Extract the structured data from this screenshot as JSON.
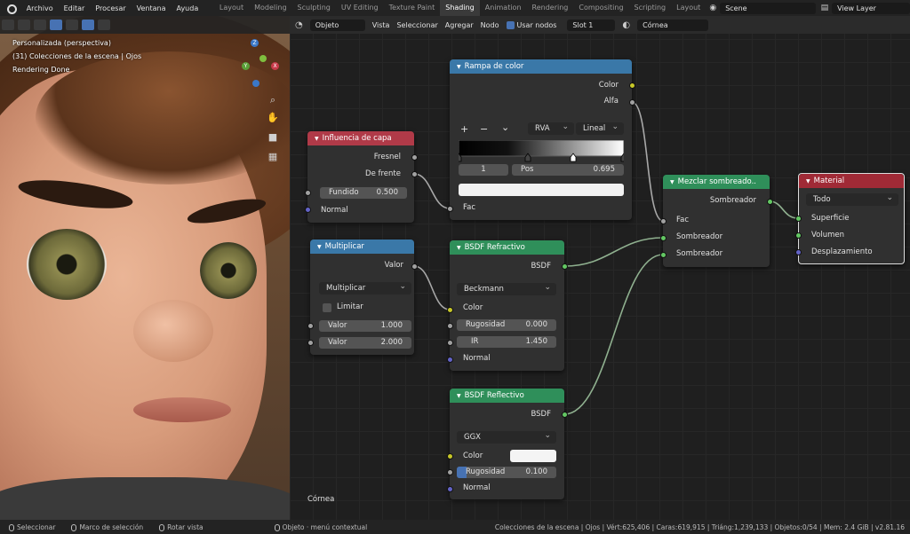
{
  "menubar": {
    "items": [
      "Archivo",
      "Editar",
      "Procesar",
      "Ventana",
      "Ayuda"
    ],
    "workspaces": [
      "Layout",
      "Modeling",
      "Sculpting",
      "UV Editing",
      "Texture Paint",
      "Shading",
      "Animation",
      "Rendering",
      "Compositing",
      "Scripting",
      "Layout"
    ],
    "active_workspace_index": 5,
    "scene": "Scene",
    "view_layer": "View Layer"
  },
  "viewport": {
    "line1": "Personalizada (perspectiva)",
    "line2": "(31) Colecciones de la escena | Ojos",
    "line3": "Rendering Done",
    "gizmo_labels": {
      "z": "Z",
      "y": "Y",
      "x": "X"
    }
  },
  "editor_header": {
    "object_mode": "Objeto",
    "menu": [
      "Vista",
      "Seleccionar",
      "Agregar",
      "Nodo"
    ],
    "use_nodes": "Usar nodos",
    "slot": "Slot 1",
    "material": "Córnea"
  },
  "editor_label": "Córnea",
  "nodes": {
    "layer_weight": {
      "title": "Influencia de capa",
      "out_fresnel": "Fresnel",
      "out_facing": "De frente",
      "blend_label": "Fundido",
      "blend_value": "0.500",
      "in_normal": "Normal"
    },
    "color_ramp": {
      "title": "Rampa de color",
      "out_color": "Color",
      "out_alpha": "Alfa",
      "btn_add": "+",
      "btn_remove": "−",
      "btn_menu": "⌄",
      "color_mode": "RVA",
      "interpolation": "Lineal",
      "stop_index": "1",
      "pos_label": "Pos",
      "pos_value": "0.695",
      "in_fac": "Fac",
      "ramp_stops": [
        0.0,
        0.42,
        0.695,
        1.0
      ]
    },
    "multiply": {
      "title": "Multiplicar",
      "out_value": "Valor",
      "operation": "Multiplicar",
      "clamp_label": "Limitar",
      "v1_label": "Valor",
      "v1_value": "1.000",
      "v2_label": "Valor",
      "v2_value": "2.000"
    },
    "refraction": {
      "title": "BSDF Refractivo",
      "out_bsdf": "BSDF",
      "distribution": "Beckmann",
      "in_color": "Color",
      "rough_label": "Rugosidad",
      "rough_value": "0.000",
      "ior_label": "IR",
      "ior_value": "1.450",
      "in_normal": "Normal"
    },
    "glossy": {
      "title": "BSDF Reflectivo",
      "out_bsdf": "BSDF",
      "distribution": "GGX",
      "in_color": "Color",
      "rough_label": "Rugosidad",
      "rough_value": "0.100",
      "rough_fraction": 0.1,
      "in_normal": "Normal"
    },
    "mix_shader": {
      "title": "Mezclar sombreado..",
      "out_shader": "Sombreador",
      "in_fac": "Fac",
      "in_shader1": "Sombreador",
      "in_shader2": "Sombreador"
    },
    "material_output": {
      "title": "Material",
      "target": "Todo",
      "in_surface": "Superficie",
      "in_volume": "Volumen",
      "in_displacement": "Desplazamiento"
    }
  },
  "statusbar": {
    "select": "Seleccionar",
    "box_select": "Marco de selección",
    "rotate": "Rotar vista",
    "context": "Objeto · menú contextual",
    "stats": "Colecciones de la escena | Ojos | Vért:625,406 | Caras:619,915 | Triáng:1,239,133 | Objetos:0/54 | Mem: 2.4 GiB | v2.81.16"
  },
  "colors": {
    "accent": "#4772b3",
    "socket_gray": "#a1a1a1",
    "socket_yellow": "#c7c729",
    "socket_green": "#63c763",
    "socket_purple": "#6363c7"
  }
}
